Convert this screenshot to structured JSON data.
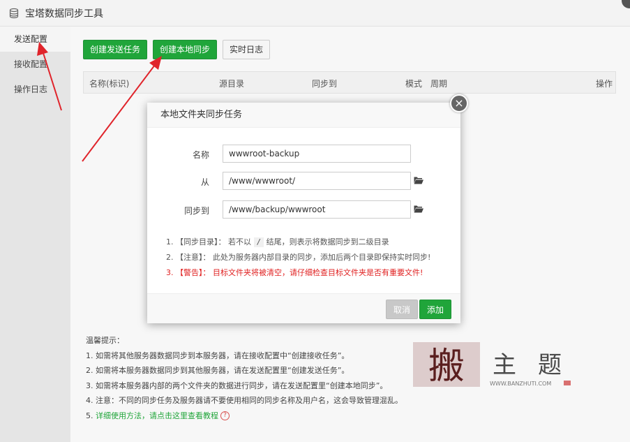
{
  "window": {
    "title": "宝塔数据同步工具"
  },
  "sidebar": {
    "items": [
      {
        "label": "发送配置"
      },
      {
        "label": "接收配置"
      },
      {
        "label": "操作日志"
      }
    ]
  },
  "toolbar": {
    "create_send_task": "创建发送任务",
    "create_local_sync": "创建本地同步",
    "realtime_log": "实时日志"
  },
  "table": {
    "columns": [
      "名称(标识)",
      "源目录",
      "同步到",
      "模式",
      "周期",
      "操作"
    ]
  },
  "tips": {
    "title": "温馨提示：",
    "lines": [
      "1. 如需将其他服务器数据同步到本服务器，请在接收配置中“创建接收任务”。",
      "2. 如需将本服务器数据同步到其他服务器，请在发送配置里“创建发送任务”。",
      "3. 如需将本服务器内部的两个文件夹的数据进行同步，请在发送配置里“创建本地同步”。",
      "4. 注意：不同的同步任务及服务器请不要使用相同的同步名称及用户名，这会导致管理混乱。"
    ],
    "line5_prefix": "5. ",
    "line5_link": "详细使用方法，请点击这里查看教程",
    "help_glyph": "?"
  },
  "watermark": {
    "chars": [
      "搬",
      "主",
      "题"
    ],
    "url": "WWW.BANZHUTI.COM"
  },
  "modal": {
    "title": "本地文件夹同步任务",
    "close_glyph": "×",
    "fields": {
      "name_label": "名称",
      "name_value": "wwwroot-backup",
      "from_label": "从",
      "from_value": "/www/wwwroot/",
      "to_label": "同步到",
      "to_value": "/www/backup/wwwroot"
    },
    "notes": {
      "n1_prefix": "1. 【同步目录】： 若不以",
      "n1_code": "/",
      "n1_suffix": "结尾，则表示将数据同步到二级目录",
      "n2": "2. 【注意】： 此处为服务器内部目录的同步，添加后两个目录即保持实时同步!",
      "n3": "3. 【警告】： 目标文件夹将被清空，请仔细检查目标文件夹是否有重要文件!"
    },
    "cancel": "取消",
    "add": "添加"
  },
  "colors": {
    "accent": "#20a53a",
    "warning": "#e02020"
  }
}
